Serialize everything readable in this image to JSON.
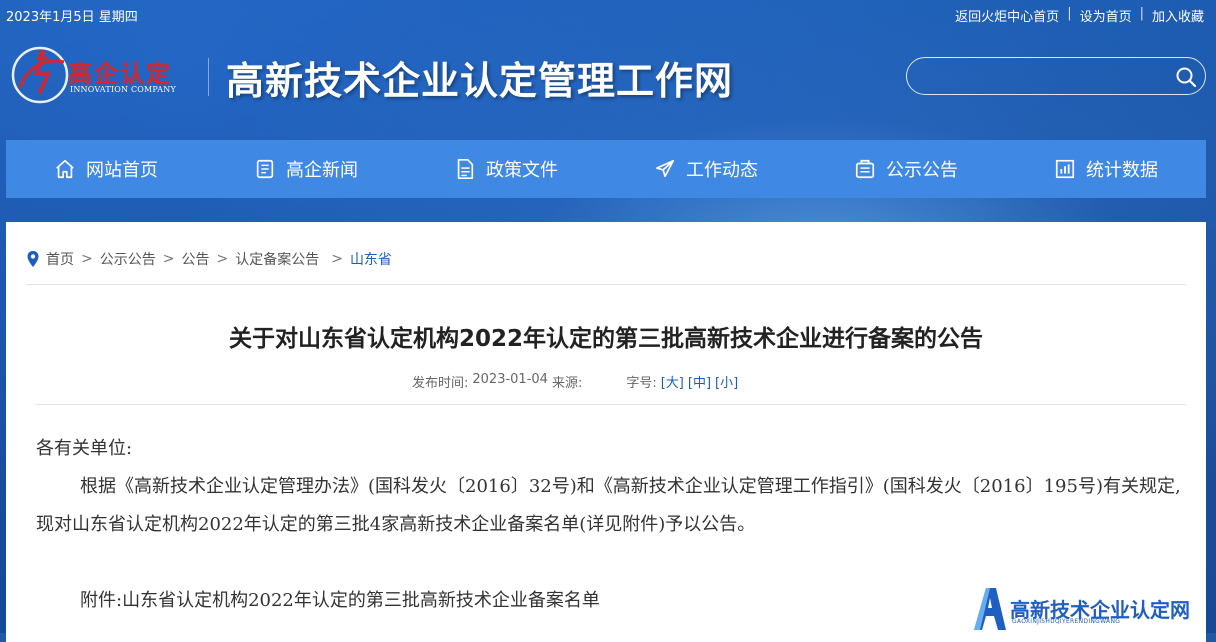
{
  "topbar": {
    "date": "2023年1月5日 星期四",
    "links": [
      "返回火炬中心首页",
      "设为首页",
      "加入收藏"
    ],
    "separator": "|"
  },
  "logo": {
    "name": "高企认定",
    "sub": "INNOVATION COMPANY"
  },
  "header": {
    "site_title": "高新技术企业认定管理工作网"
  },
  "search": {
    "value": "",
    "placeholder": ""
  },
  "nav": {
    "items": [
      {
        "label": "网站首页",
        "icon": "home-icon"
      },
      {
        "label": "高企新闻",
        "icon": "news-icon"
      },
      {
        "label": "政策文件",
        "icon": "document-icon"
      },
      {
        "label": "工作动态",
        "icon": "send-icon"
      },
      {
        "label": "公示公告",
        "icon": "announcement-icon"
      },
      {
        "label": "统计数据",
        "icon": "chart-icon"
      }
    ]
  },
  "breadcrumb": {
    "items": [
      "首页",
      "公示公告",
      "公告",
      "认定备案公告"
    ],
    "current": "山东省",
    "separator": ">"
  },
  "article": {
    "title": "关于对山东省认定机构2022年认定的第三批高新技术企业进行备案的公告",
    "publish_label": "发布时间:",
    "publish_date": "2023-01-04",
    "source_label": "来源:",
    "size_label": "字号:",
    "size_large": "[大]",
    "size_medium": "[中]",
    "size_small": "[小]",
    "salutation": "各有关单位:",
    "paragraph": "根据《高新技术企业认定管理办法》(国科发火〔2016〕32号)和《高新技术企业认定管理工作指引》(国科发火〔2016〕195号)有关规定,现对山东省认定机构2022年认定的第三批4家高新技术企业备案名单(详见附件)予以公告。",
    "attachment": "附件:山东省认定机构2022年认定的第三批高新技术企业备案名单"
  },
  "watermark": {
    "text": "高新技术企业认定网",
    "sub": "GAOXINJISHUQIYERENDINGWANG"
  },
  "colors": {
    "header_bg": "#1d5db3",
    "nav_bg": "#3f88e3",
    "link_accent": "#1a5fc0",
    "logo_red": "#d7262b"
  }
}
